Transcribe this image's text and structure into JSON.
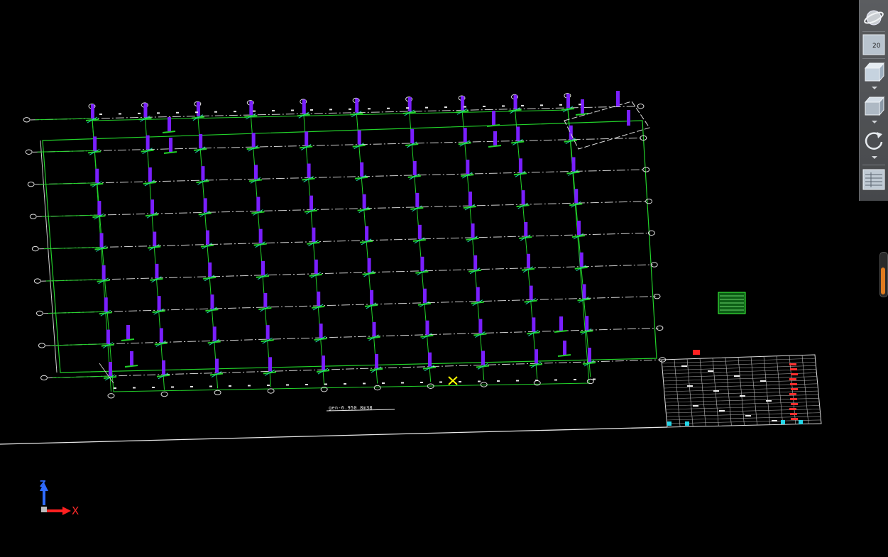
{
  "toolbar": {
    "zoom_value": "20",
    "buttons": [
      "orbit",
      "zoom-window",
      "view-cube-front",
      "view-cube-back",
      "rotate",
      "layer-table"
    ]
  },
  "drawing": {
    "elevation_label": "gen-6.950 8m38",
    "ucs_x": "X",
    "ucs_z": "Z"
  },
  "colors": {
    "column": "#7a1fff",
    "grid_line": "#22d22a",
    "axis_line": "#cfcfcf",
    "background": "#000000",
    "selection_marker": "#ffff00"
  },
  "scrollbar": {
    "position_fraction": 0.6
  }
}
